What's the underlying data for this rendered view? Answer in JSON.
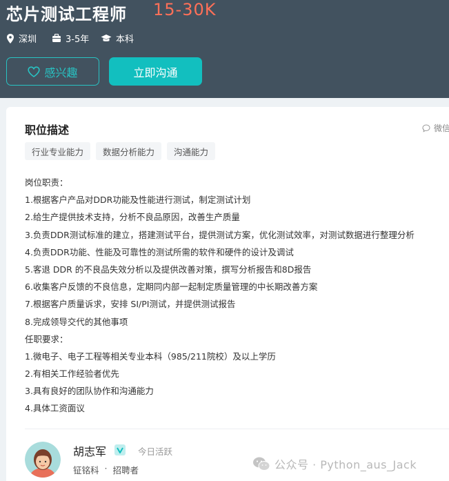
{
  "job": {
    "title": "芯片测试工程师",
    "salary": "15-30K",
    "location": "深圳",
    "experience": "3-5年",
    "education": "本科"
  },
  "actions": {
    "favorite_label": "感兴趣",
    "chat_label": "立即沟通"
  },
  "description": {
    "section_title": "职位描述",
    "wechat_label": "微信",
    "tags": [
      "行业专业能力",
      "数据分析能力",
      "沟通能力"
    ],
    "lines": [
      "岗位职责：",
      "1.根据客户产品对DDR功能及性能进行测试，制定测试计划",
      "2.给生产提供技术支持，分析不良品原因，改善生产质量",
      "3.负责DDR测试标准的建立，搭建测试平台，提供测试方案，优化测试效率，对测试数据进行整理分析",
      "4.负责DDR功能、性能及可靠性的测试所需的软件和硬件的设计及调试",
      "5.客退 DDR 的不良品失效分析以及提供改善对策，撰写分析报告和8D报告",
      "6.收集客户反馈的不良信息，定期同内部一起制定质量管理的中长期改善方案",
      "7.根据客户质量诉求，安排 SI/PI测试，并提供测试报告",
      "8.完成领导交代的其他事项",
      "任职要求：",
      "1.微电子、电子工程等相关专业本科（985/211院校）及以上学历",
      "2.有相关工作经验者优先",
      "3.具有良好的团队协作和沟通能力",
      "4.具体工资面议"
    ]
  },
  "recruiter": {
    "name": "胡志军",
    "active_status": "今日活跃",
    "company": "钲铭科",
    "separator": "·",
    "role": "招聘者"
  },
  "watermark": {
    "text": "公众号 · Python_aus_Jack"
  },
  "colors": {
    "header_bg": "#42525f",
    "salary": "#ff7058",
    "accent": "#12bfbf"
  }
}
